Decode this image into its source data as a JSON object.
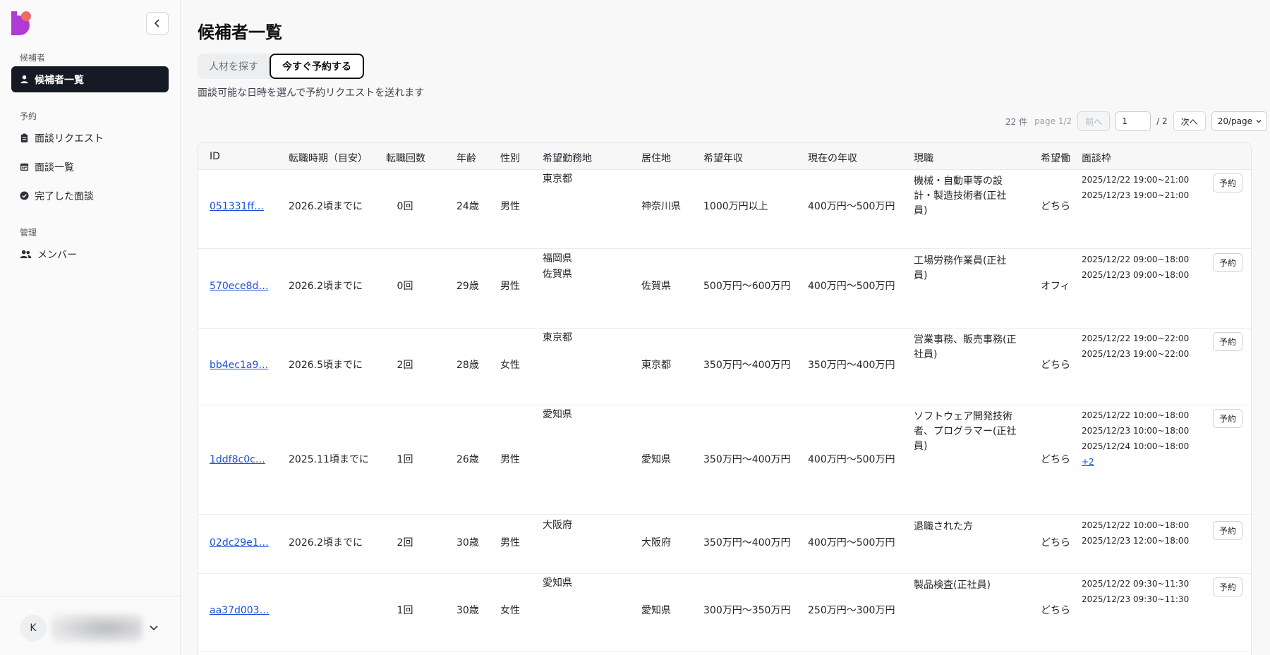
{
  "sidebar": {
    "sections": [
      {
        "label": "候補者",
        "items": [
          {
            "label": "候補者一覧",
            "icon": "person-icon",
            "active": true
          }
        ]
      },
      {
        "label": "予約",
        "items": [
          {
            "label": "面談リクエスト",
            "icon": "clipboard-icon"
          },
          {
            "label": "面談一覧",
            "icon": "calendar-icon"
          },
          {
            "label": "完了した面談",
            "icon": "check-circle-icon"
          }
        ]
      },
      {
        "label": "管理",
        "items": [
          {
            "label": "メンバー",
            "icon": "people-icon"
          }
        ]
      }
    ],
    "user": {
      "initial": "K"
    }
  },
  "page": {
    "title": "候補者一覧",
    "tabs": [
      {
        "label": "人材を探す"
      },
      {
        "label": "今すぐ予約する",
        "active": true
      }
    ],
    "subtitle": "面談可能な日時を選んで予約リクエストを送れます"
  },
  "pager": {
    "count": "22 件",
    "page_info": "page 1/2",
    "prev": "前へ",
    "current": "1",
    "total": "/ 2",
    "next": "次へ",
    "page_size": "20/page"
  },
  "table": {
    "columns": [
      "ID",
      "転職時期（目安）",
      "転職回数",
      "年齢",
      "性別",
      "希望勤務地",
      "居住地",
      "希望年収",
      "現在の年収",
      "現職",
      "希望働",
      "面談枠"
    ],
    "reserve_label": "予約",
    "rows": [
      {
        "id": "051331ff…",
        "timing": "2026.2頃までに",
        "changes": "0回",
        "age": "24歳",
        "gender": "男性",
        "pref_loc": [
          "東京都"
        ],
        "residence": "神奈川県",
        "pref_salary": "1000万円以上",
        "cur_salary": "400万円〜500万円",
        "job": "機械・自動車等の設計・製造技術者(正社員)",
        "work_style": "どちら",
        "slots": [
          "2025/12/22 19:00~21:00",
          "2025/12/23 19:00~21:00"
        ]
      },
      {
        "id": "570ece8d…",
        "timing": "2026.2頃までに",
        "changes": "0回",
        "age": "29歳",
        "gender": "男性",
        "pref_loc": [
          "福岡県",
          "佐賀県"
        ],
        "residence": "佐賀県",
        "pref_salary": "500万円〜600万円",
        "cur_salary": "400万円〜500万円",
        "job": "工場労務作業員(正社員)",
        "work_style": "オフィ",
        "slots": [
          "2025/12/22 09:00~18:00",
          "2025/12/23 09:00~18:00"
        ]
      },
      {
        "id": "bb4ec1a9…",
        "timing": "2026.5頃までに",
        "changes": "2回",
        "age": "28歳",
        "gender": "女性",
        "pref_loc": [
          "東京都"
        ],
        "residence": "東京都",
        "pref_salary": "350万円〜400万円",
        "cur_salary": "350万円〜400万円",
        "job": "営業事務、販売事務(正社員)",
        "work_style": "どちら",
        "slots": [
          "2025/12/22 19:00~22:00",
          "2025/12/23 19:00~22:00"
        ]
      },
      {
        "id": "1ddf8c0c…",
        "timing": "2025.11頃までに",
        "changes": "1回",
        "age": "26歳",
        "gender": "男性",
        "pref_loc": [
          "愛知県"
        ],
        "residence": "愛知県",
        "pref_salary": "350万円〜400万円",
        "cur_salary": "400万円〜500万円",
        "job": "ソフトウェア開発技術者、プログラマー(正社員)",
        "work_style": "どちら",
        "slots": [
          "2025/12/22 10:00~18:00",
          "2025/12/23 10:00~18:00",
          "2025/12/24 10:00~18:00"
        ],
        "more": "+2"
      },
      {
        "id": "02dc29e1…",
        "timing": "2026.2頃までに",
        "changes": "2回",
        "age": "30歳",
        "gender": "男性",
        "pref_loc": [
          "大阪府"
        ],
        "residence": "大阪府",
        "pref_salary": "350万円〜400万円",
        "cur_salary": "400万円〜500万円",
        "job": "退職された方",
        "work_style": "どちら",
        "slots": [
          "2025/12/22 10:00~18:00",
          "2025/12/23 12:00~18:00"
        ]
      },
      {
        "id": "aa37d003…",
        "timing": "",
        "changes": "1回",
        "age": "30歳",
        "gender": "女性",
        "pref_loc": [
          "愛知県"
        ],
        "residence": "愛知県",
        "pref_salary": "300万円〜350万円",
        "cur_salary": "250万円〜300万円",
        "job": "製品検査(正社員)",
        "work_style": "どちら",
        "slots": [
          "2025/12/22 09:30~11:30",
          "2025/12/23 09:30~11:30"
        ]
      }
    ]
  }
}
